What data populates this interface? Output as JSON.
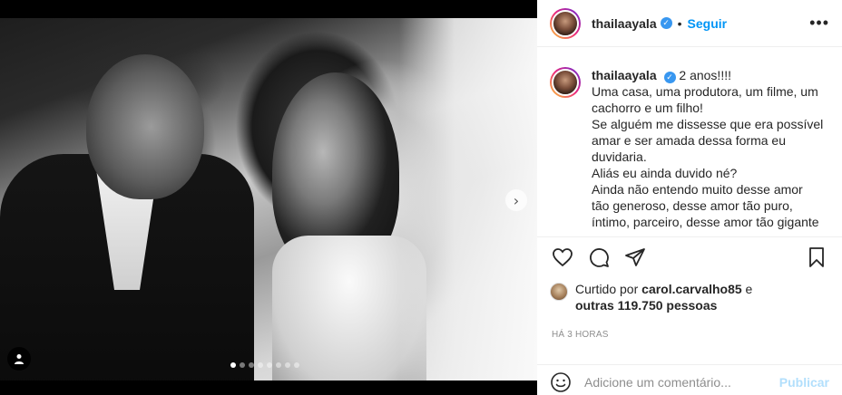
{
  "post": {
    "username": "thailaayala",
    "follow_label": "Seguir",
    "more_label": "•••",
    "separator": "•",
    "caption_lines": [
      "Uma casa, uma produtora, um filme, um",
      "cachorro e um filho!",
      "Se alguém me dissesse que era possível",
      "amar e ser amada dessa forma eu",
      "duvidaria.",
      "Aliás eu ainda duvido né?",
      "Ainda não entendo muito desse amor",
      "tão generoso, desse amor tão puro,",
      "íntimo, parceiro, desse amor tão gigante"
    ],
    "caption_first": "2 anos!!!!",
    "liked_by_prefix": "Curtido por ",
    "liked_by_user": "carol.carvalho85",
    "liked_by_and": " e",
    "liked_by_others": "outras 119.750 pessoas",
    "timestamp": "Há 3 horas",
    "comment_placeholder": "Adicione um comentário...",
    "publish_label": "Publicar"
  },
  "carousel": {
    "total_slides": 8,
    "active_index": 0,
    "next_label": "›"
  },
  "colors": {
    "accent": "#0095f6",
    "verified": "#3897f0",
    "publish_disabled": "#b2dffc"
  },
  "icons": [
    "heart-icon",
    "comment-icon",
    "share-icon",
    "bookmark-icon",
    "emoji-icon",
    "verified-icon",
    "user-tag-icon",
    "chevron-right-icon"
  ]
}
